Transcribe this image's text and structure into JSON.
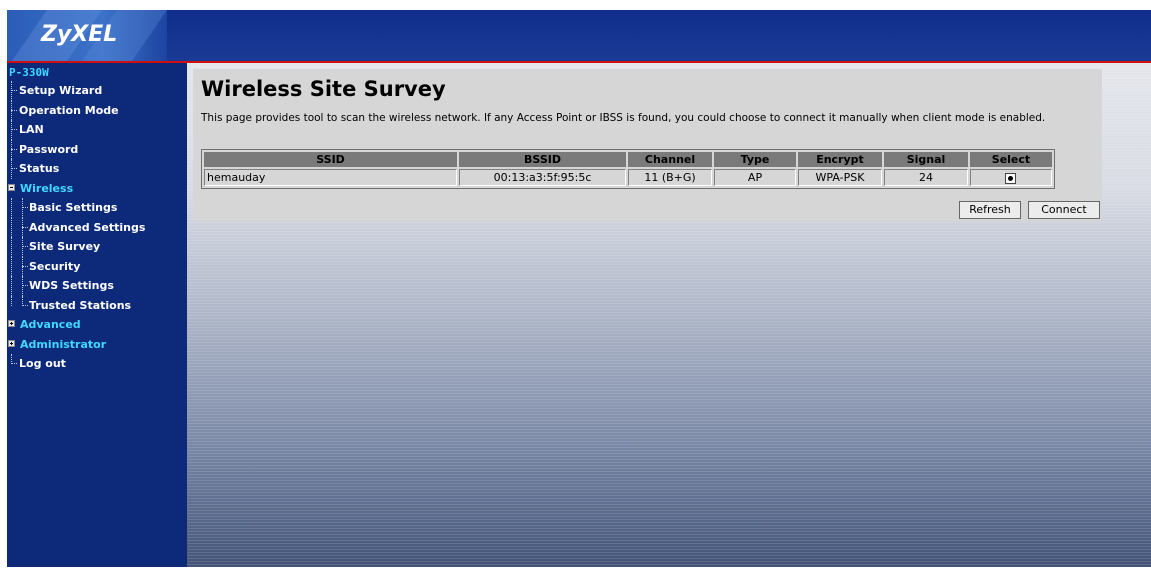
{
  "brand": {
    "logo": "ZyXEL"
  },
  "sidebar": {
    "model": "P-330W",
    "items": [
      {
        "label": "Setup Wizard"
      },
      {
        "label": "Operation Mode"
      },
      {
        "label": "LAN"
      },
      {
        "label": "Password"
      },
      {
        "label": "Status"
      }
    ],
    "wireless": {
      "label": "Wireless",
      "icon": "minus-expander-icon",
      "children": [
        {
          "label": "Basic Settings"
        },
        {
          "label": "Advanced Settings"
        },
        {
          "label": "Site Survey"
        },
        {
          "label": "Security"
        },
        {
          "label": "WDS Settings"
        },
        {
          "label": "Trusted Stations"
        }
      ]
    },
    "advanced": {
      "label": "Advanced",
      "icon": "plus-expander-icon"
    },
    "administrator": {
      "label": "Administrator",
      "icon": "plus-expander-icon"
    },
    "logout": {
      "label": "Log out"
    }
  },
  "page": {
    "title": "Wireless Site Survey",
    "description": "This page provides tool to scan the wireless network. If any Access Point or IBSS is found, you could choose to connect it manually when client mode is enabled."
  },
  "table": {
    "headers": [
      "SSID",
      "BSSID",
      "Channel",
      "Type",
      "Encrypt",
      "Signal",
      "Select"
    ],
    "rows": [
      {
        "ssid": "hemauday",
        "bssid": "00:13:a3:5f:95:5c",
        "channel": "11 (B+G)",
        "type": "AP",
        "encrypt": "WPA-PSK",
        "signal": "24",
        "selected": true
      }
    ]
  },
  "buttons": {
    "refresh": "Refresh",
    "connect": "Connect"
  },
  "colors": {
    "header_bg": "#0f2e8c",
    "sidebar_bg": "#0d2a7a",
    "accent_line": "#d01010",
    "folder_text": "#40d8ff"
  }
}
